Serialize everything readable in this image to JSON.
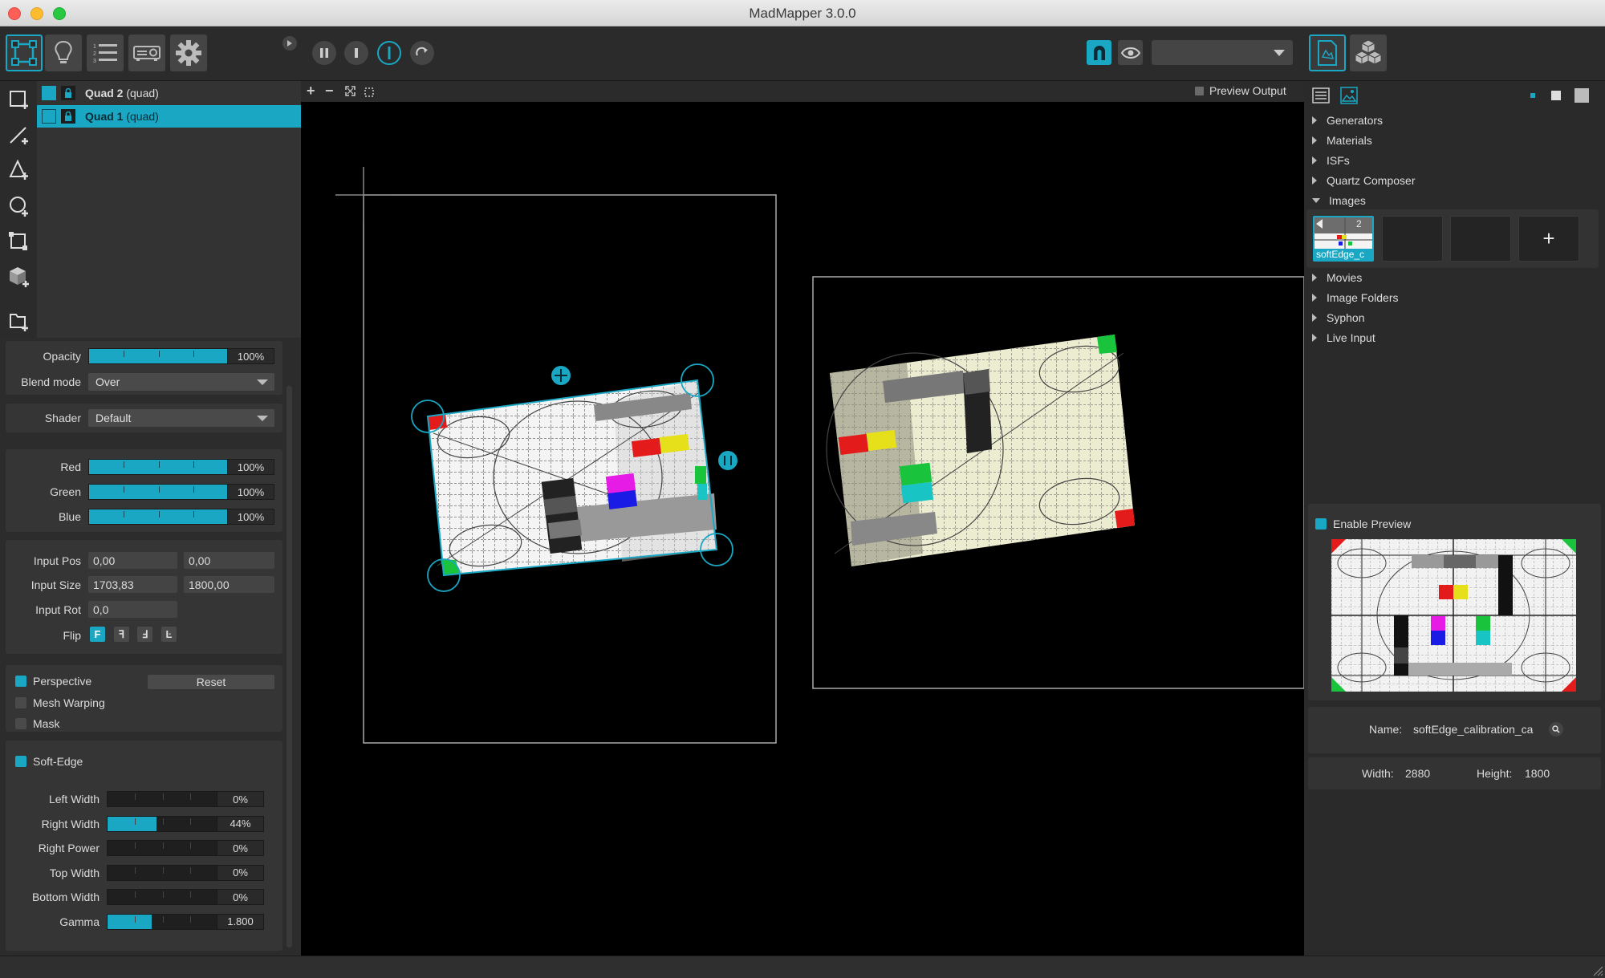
{
  "window": {
    "title": "MadMapper 3.0.0"
  },
  "toolbar": {
    "modes": [
      {
        "name": "surfaces-mode",
        "icon": "quad-surface-icon",
        "active": true
      },
      {
        "name": "lights-mode",
        "icon": "bulb-icon",
        "active": false
      },
      {
        "name": "cue-list-mode",
        "icon": "list-icon",
        "active": false
      },
      {
        "name": "output-mode",
        "icon": "projector-icon",
        "active": false
      },
      {
        "name": "settings-mode",
        "icon": "gear-icon",
        "active": false
      }
    ],
    "transport": [
      "pause-icon",
      "stop-icon",
      "power-icon",
      "reload-icon"
    ],
    "output_select": {
      "value": ""
    },
    "right_tabs": [
      "media-library-icon",
      "cube-icon"
    ]
  },
  "left_tools": [
    "add-quad-icon",
    "add-line-icon",
    "add-triangle-icon",
    "add-circle-icon",
    "add-mask-icon",
    "add-3d-object-icon",
    "add-folder-icon"
  ],
  "layers": [
    {
      "name": "Quad 2",
      "type": "(quad)",
      "selected": false
    },
    {
      "name": "Quad 1",
      "type": "(quad)",
      "selected": true
    }
  ],
  "properties": {
    "opacity": {
      "label": "Opacity",
      "value": "100%",
      "fraction": 1.0
    },
    "blend_mode": {
      "label": "Blend mode",
      "value": "Over"
    },
    "shader": {
      "label": "Shader",
      "value": "Default"
    },
    "red": {
      "label": "Red",
      "value": "100%",
      "fraction": 1.0
    },
    "green": {
      "label": "Green",
      "value": "100%",
      "fraction": 1.0
    },
    "blue": {
      "label": "Blue",
      "value": "100%",
      "fraction": 1.0
    },
    "input_pos": {
      "label": "Input Pos",
      "x": "0,00",
      "y": "0,00"
    },
    "input_size": {
      "label": "Input Size",
      "w": "1703,83",
      "h": "1800,00"
    },
    "input_rot": {
      "label": "Input Rot",
      "value": "0,0"
    },
    "flip": {
      "label": "Flip",
      "buttons": [
        "F",
        "ꟻ",
        "Ⅎ",
        "Ŀ"
      ]
    },
    "perspective": {
      "label": "Perspective",
      "checked": true,
      "reset_label": "Reset"
    },
    "mesh_warping": {
      "label": "Mesh Warping",
      "checked": false
    },
    "mask": {
      "label": "Mask",
      "checked": false
    },
    "soft_edge": {
      "label": "Soft-Edge",
      "checked": true,
      "params": [
        {
          "label": "Left Width",
          "value": "0%",
          "fraction": 0
        },
        {
          "label": "Right Width",
          "value": "44%",
          "fraction": 0.44
        },
        {
          "label": "Right Power",
          "value": "0%",
          "fraction": 0
        },
        {
          "label": "Top Width",
          "value": "0%",
          "fraction": 0
        },
        {
          "label": "Bottom Width",
          "value": "0%",
          "fraction": 0
        },
        {
          "label": "Gamma",
          "value": "1.800",
          "fraction": 0.4
        }
      ]
    }
  },
  "canvas": {
    "preview_output_label": "Preview Output"
  },
  "library": {
    "categories": [
      {
        "label": "Generators",
        "expanded": false
      },
      {
        "label": "Materials",
        "expanded": false
      },
      {
        "label": "ISFs",
        "expanded": false
      },
      {
        "label": "Quartz Composer",
        "expanded": false
      },
      {
        "label": "Images",
        "expanded": true
      },
      {
        "label": "Movies",
        "expanded": false
      },
      {
        "label": "Image Folders",
        "expanded": false
      },
      {
        "label": "Syphon",
        "expanded": false
      },
      {
        "label": "Live Input",
        "expanded": false
      }
    ],
    "image_thumb": {
      "label": "softEdge_c",
      "count": "2"
    },
    "add_label": "+"
  },
  "preview": {
    "enable_label": "Enable Preview",
    "enabled": true,
    "name_label": "Name:",
    "name_value": "softEdge_calibration_ca",
    "width_label": "Width:",
    "width_value": "2880",
    "height_label": "Height:",
    "height_value": "1800"
  }
}
